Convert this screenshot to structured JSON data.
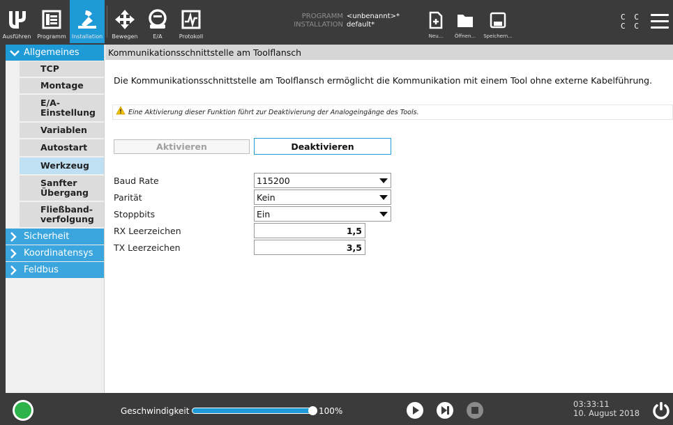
{
  "topbar": {
    "tabs": [
      {
        "label": "Ausführen",
        "icon": "ur-logo-icon"
      },
      {
        "label": "Programm",
        "icon": "program-tree-icon"
      },
      {
        "label": "Installation",
        "icon": "installation-icon",
        "active": true
      }
    ],
    "tools": [
      {
        "label": "Bewegen",
        "icon": "move-arrows-icon"
      },
      {
        "label": "E/A",
        "icon": "io-icon"
      },
      {
        "label": "Protokoll",
        "icon": "log-icon"
      }
    ],
    "program_key": "PROGRAMM",
    "program_value": "<unbenannt>*",
    "installation_key": "INSTALLATION",
    "installation_value": "default*",
    "file_buttons": [
      {
        "label": "Neu...",
        "icon": "new-file-icon"
      },
      {
        "label": "Öffnen...",
        "icon": "folder-icon"
      },
      {
        "label": "Speichern...",
        "icon": "save-icon"
      }
    ],
    "cc_line1": "C C",
    "cc_line2": "C C"
  },
  "sidebar": {
    "groups": [
      {
        "label": "Allgemeines",
        "expanded": true,
        "items": [
          {
            "label": "TCP"
          },
          {
            "label": "Montage"
          },
          {
            "label": "E/A-\nEinstellung"
          },
          {
            "label": "Variablen"
          },
          {
            "label": "Autostart"
          },
          {
            "label": "Werkzeug",
            "active": true
          },
          {
            "label": "Sanfter\nÜbergang"
          },
          {
            "label": "Fließband-\nverfolgung"
          }
        ]
      },
      {
        "label": "Sicherheit",
        "expanded": false
      },
      {
        "label": "Koordinatensys",
        "expanded": false
      },
      {
        "label": "Feldbus",
        "expanded": false
      }
    ]
  },
  "content": {
    "header": "Kommunikationsschnittstelle am Toolflansch",
    "description": "Die Kommunikationsschnittstelle am Toolflansch ermöglicht die Kommunikation mit einem Tool ohne externe Kabelführung.",
    "warning": "Eine Aktivierung dieser Funktion führt zur Deaktivierung der Analogeingänge des Tools.",
    "activate_label": "Aktivieren",
    "deactivate_label": "Deaktivieren",
    "fields": {
      "baud_rate": {
        "label": "Baud Rate",
        "value": "115200"
      },
      "parity": {
        "label": "Parität",
        "value": "Kein"
      },
      "stopbits": {
        "label": "Stoppbits",
        "value": "Ein"
      },
      "rx_idle": {
        "label": "RX Leerzeichen",
        "value": "1,5"
      },
      "tx_idle": {
        "label": "TX Leerzeichen",
        "value": "3,5"
      }
    }
  },
  "bottombar": {
    "speed_label": "Geschwindigkeit",
    "speed_value": "100%",
    "speed_fraction": 1.0,
    "time": "03:33:11",
    "date": "10. August 2018",
    "colors": {
      "accent": "#1e9ad6",
      "status_ok": "#2eb24a"
    }
  }
}
